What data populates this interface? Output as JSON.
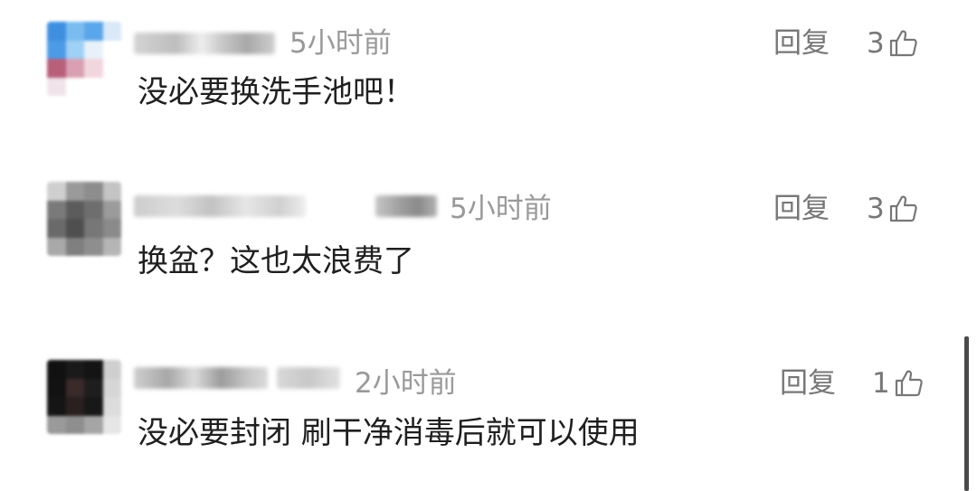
{
  "comments": [
    {
      "time": "5小时前",
      "text": "没必要换洗手池吧！",
      "reply_label": "回复",
      "likes": "3",
      "like_icon": "thumbs-up-icon",
      "avatar_colors": [
        "#3f8fe0",
        "#7bbcf0",
        "#5aa6ea",
        "#d9e9f8",
        "#4d9be6",
        "#9fd0f5",
        "#e8f1fa",
        "#ffffff",
        "#b85f7a",
        "#d8a0b2",
        "#f2d6de",
        "#ffffff",
        "#f0e4ea",
        "#ffffff",
        "#ffffff",
        "#ffffff"
      ]
    },
    {
      "time": "5小时前",
      "text": "换盆？这也太浪费了",
      "reply_label": "回复",
      "likes": "3",
      "like_icon": "thumbs-up-icon",
      "avatar_colors": [
        "#cfcfcf",
        "#9a9a9a",
        "#8d8d8d",
        "#c4c4c4",
        "#7a7a7a",
        "#5c5c5c",
        "#6e6e6e",
        "#9b9b9b",
        "#6a6a6a",
        "#4f4f4f",
        "#777777",
        "#8a8a8a",
        "#a9a9a9",
        "#7f7f7f",
        "#8e8e8e",
        "#b5b5b5"
      ]
    },
    {
      "time": "2小时前",
      "text": "没必要封闭 刷干净消毒后就可以使用",
      "reply_label": "回复",
      "likes": "1",
      "like_icon": "thumbs-up-icon",
      "avatar_colors": [
        "#111111",
        "#1a1a1a",
        "#141414",
        "#cfcfcf",
        "#121212",
        "#3a2a2a",
        "#1e1e1e",
        "#d6d6d6",
        "#151515",
        "#2a2020",
        "#181818",
        "#dcdcdc",
        "#9a9a9a",
        "#8e8e8e",
        "#a5a5a5",
        "#e6e6e6"
      ]
    }
  ]
}
